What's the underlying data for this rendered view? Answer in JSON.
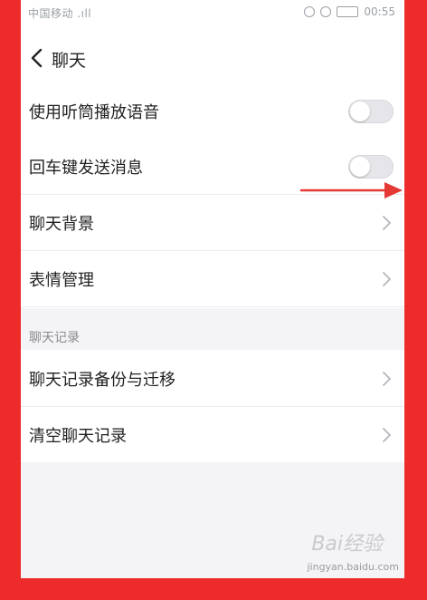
{
  "status_bar": {
    "left_text": "中国移动 .ıll",
    "right_text": "00:55"
  },
  "nav": {
    "title": "聊天"
  },
  "settings": {
    "rows": [
      {
        "label": "使用听筒播放语音",
        "control": "toggle",
        "on": false
      },
      {
        "label": "回车键发送消息",
        "control": "toggle",
        "on": false
      },
      {
        "label": "聊天背景",
        "control": "chevron"
      },
      {
        "label": "表情管理",
        "control": "chevron"
      }
    ],
    "section_header": "聊天记录",
    "history_rows": [
      {
        "label": "聊天记录备份与迁移",
        "control": "chevron"
      },
      {
        "label": "清空聊天记录",
        "control": "chevron"
      }
    ]
  },
  "annotation": {
    "arrow_color": "#e53935"
  },
  "watermark": {
    "brand": "Bai经验",
    "url": "jingyan.baidu.com"
  },
  "colors": {
    "frame": "#ee2b2b",
    "section_bg": "#f4f4f6"
  }
}
